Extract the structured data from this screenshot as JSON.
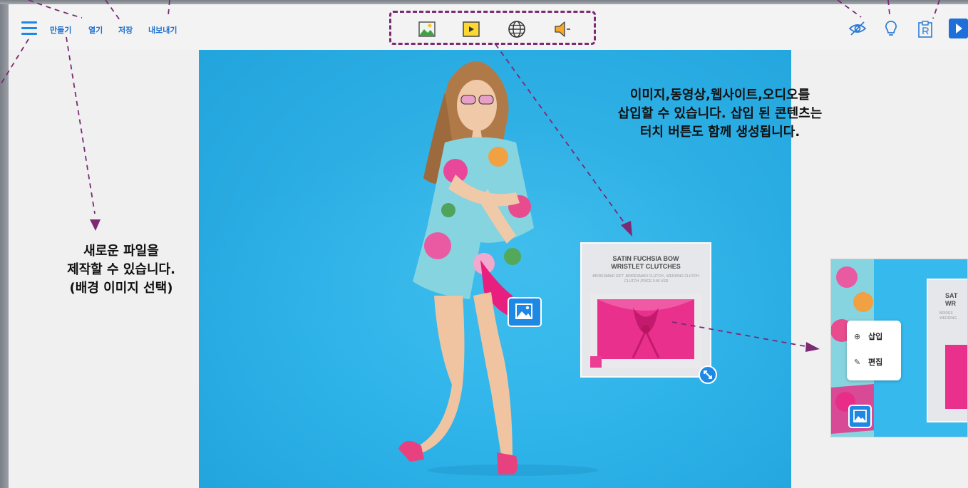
{
  "toolbar": {
    "menu_buttons": [
      "만들기",
      "열기",
      "저장",
      "내보내기"
    ]
  },
  "insert_tools": [
    "image-icon",
    "video-icon",
    "website-icon",
    "audio-icon"
  ],
  "right_tools": [
    "hide-icon",
    "lightbulb-icon",
    "clipboard-icon",
    "play-icon"
  ],
  "callouts": {
    "insert": [
      "이미지,동영상,웹사이트,오디오를",
      "삽입할 수 있습니다. 삽입 된 콘텐츠는",
      "터치 버튼도 함께 생성됩니다."
    ],
    "new_file": [
      "새로운 파일을",
      "제작할 수 있습니다.",
      "(배경 이미지 선택)"
    ]
  },
  "product_card": {
    "title_line1": "SATIN FUCHSIA BOW",
    "title_line2": "WRISTLET CLUTCHES",
    "subtitle": "BRIDESMAID GIFT ,BRIDESMAID CLUTCH , WEDDING CLUTCH ,CLUTCH ,PRICE 9.90 USD"
  },
  "thumbnail": {
    "title_fragment1": "SAT",
    "title_fragment2": "WR",
    "sub_fragment1": "BRIDES",
    "sub_fragment2": "WEDDING"
  },
  "context_menu": {
    "insert_label": "삽입",
    "edit_label": "편집"
  },
  "colors": {
    "accent": "#1e88e5",
    "canvas_bg": "#2fb4ea",
    "annotation": "#7b2a73"
  }
}
